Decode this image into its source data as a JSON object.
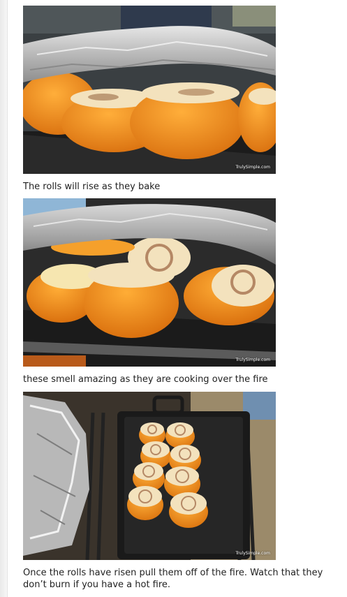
{
  "captions": {
    "first": "The rolls will rise as they bake",
    "second": "these smell amazing as they are cooking over the fire",
    "third": "Once the rolls have risen pull them off of the fire.  Watch that they don’t burn if you have a hot fire."
  },
  "watermarks": {
    "first": "TrulySimple.com",
    "second": "TrulySimple.com",
    "third": "TrulySimple.com"
  },
  "colors": {
    "orange_peel": "#f08a1c",
    "foil": "#c9c9c9",
    "griddle": "#1e1e1e",
    "dough": "#f3e2bd"
  }
}
